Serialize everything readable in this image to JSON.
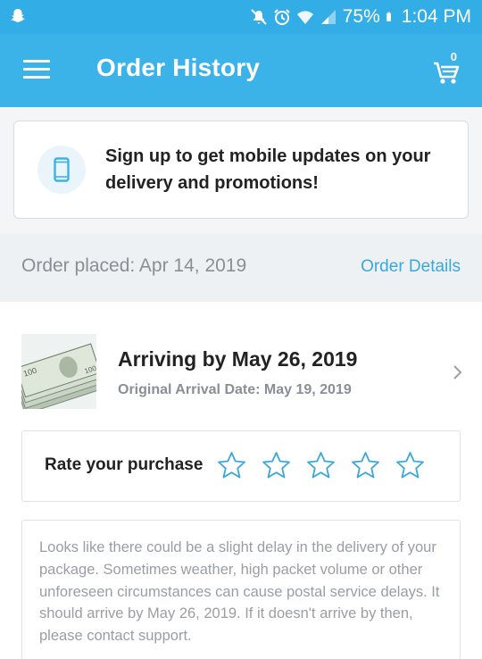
{
  "status_bar": {
    "battery": "75%",
    "time": "1:04 PM"
  },
  "app_bar": {
    "title": "Order History",
    "cart_count": "0"
  },
  "banner": {
    "text": "Sign up to get mobile updates on your delivery and promotions!"
  },
  "order": {
    "placed": "Order placed: Apr 14, 2019",
    "details_link": "Order Details",
    "item": {
      "arriving": "Arriving by May 26, 2019",
      "original_date": "Original Arrival Date: May 19, 2019"
    },
    "rating": {
      "label": "Rate your purchase",
      "stars_filled": 0,
      "stars_total": 5
    },
    "delay_message": "Looks like there could be a slight delay in the delivery of your package. Sometimes weather, high packet volume or other unforeseen circumstances can cause postal service delays. It should arrive by May 26, 2019. If it doesn't arrive by then, please contact support."
  },
  "colors": {
    "header_blue": "#3bb3e9",
    "link_blue": "#3aa8dc",
    "star_outline": "#3aa8dc"
  },
  "icons": [
    "snapchat-icon",
    "mute-icon",
    "alarm-icon",
    "wifi-icon",
    "signal-icon",
    "battery-icon",
    "menu-icon",
    "cart-icon",
    "phone-icon",
    "money-thumbnail",
    "chevron-right-icon",
    "star-icon"
  ]
}
